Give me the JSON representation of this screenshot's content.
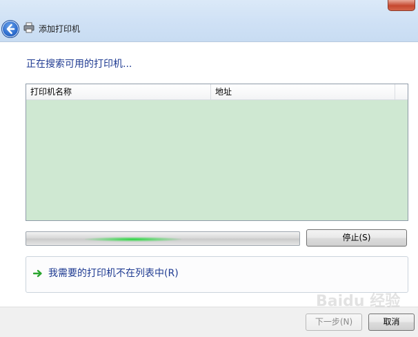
{
  "window": {
    "title": "添加打印机"
  },
  "heading": "正在搜索可用的打印机...",
  "list": {
    "columns": [
      "打印机名称",
      "地址"
    ]
  },
  "progress": {
    "status": "searching"
  },
  "buttons": {
    "stop": "停止(S)",
    "next": "下一步(N)",
    "cancel": "取消"
  },
  "link": "我需要的打印机不在列表中(R)",
  "watermark": "Baidu 经验",
  "colors": {
    "list_bg": "#cfe8d2",
    "heading": "#1e3a91",
    "progress_glow": "#22d43a"
  }
}
